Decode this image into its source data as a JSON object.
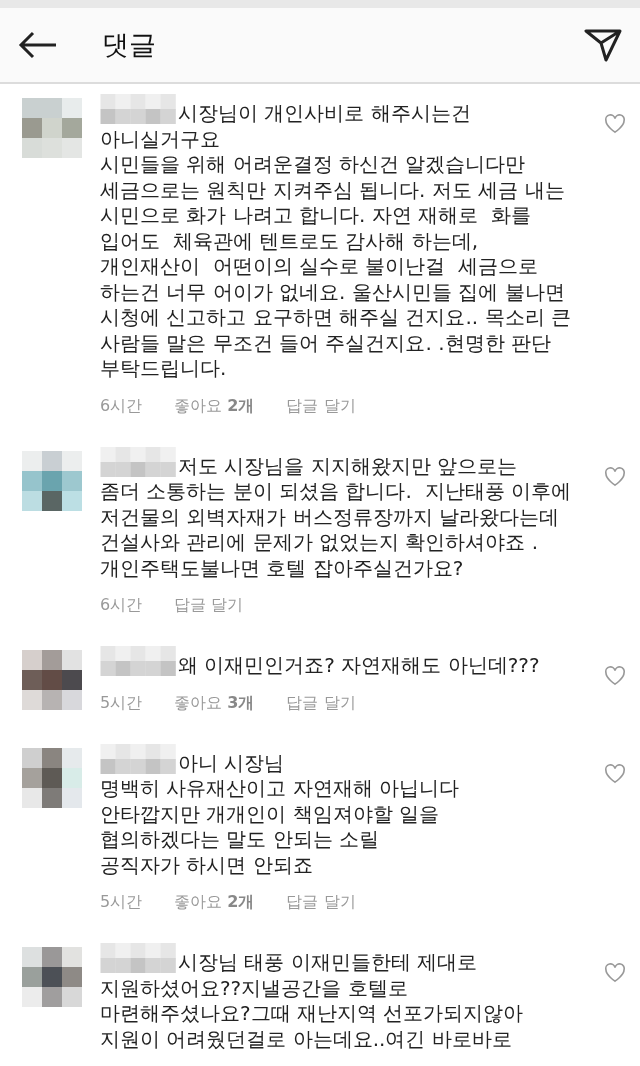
{
  "header": {
    "title": "댓글"
  },
  "comments": [
    {
      "text": "시장님이 개인사비로 해주시는건\n아니실거구요\n시민들을 위해 어려운결정 하신건 알겠습니다만\n세금으로는 원칙만 지켜주심 됩니다. 저도 세금 내는\n시민으로 화가 나려고 합니다. 자연 재해로  화를\n입어도  체육관에 텐트로도 감사해 하는데,\n개인재산이  어떤이의 실수로 불이난걸  세금으로\n하는건 너무 어이가 없네요. 울산시민들 집에 불나면\n시청에 신고하고 요구하면 해주실 건지요.. 목소리 큰\n사람들 말은 무조건 들어 주실건지요. .현명한 판단\n부탁드립니다.",
      "time": "6시간",
      "likes": "좋아요 **2개**",
      "reply": "답글 달기",
      "liked": false
    },
    {
      "text": "저도 시장님을 지지해왔지만 앞으로는\n좀더 소통하는 분이 되셨음 합니다.  지난태풍 이후에\n저건물의 외벽자재가 버스정류장까지 날라왔다는데\n건설사와 관리에 문제가 없었는지 확인하셔야죠 .\n개인주택도불나면 호텔 잡아주실건가요?",
      "time": "6시간",
      "reply": "답글 달기",
      "liked": false
    },
    {
      "text": "왜 이재민인거죠? 자연재해도 아닌데???",
      "time": "5시간",
      "likes": "좋아요 **3개**",
      "reply": "답글 달기",
      "liked": false
    },
    {
      "text": "아니 시장님\n명백히 사유재산이고 자연재해 아닙니다\n안타깝지만 개개인이 책임져야할 일을\n협의하겠다는 말도 안되는 소릴\n공직자가 하시면 안되죠",
      "time": "5시간",
      "likes": "좋아요 **2개**",
      "reply": "답글 달기",
      "liked": false
    },
    {
      "text": "시장님 태풍 이재민들한테 제대로\n지원하셨어요??지낼공간을 호텔로\n마련해주셨나요?그때 재난지역 선포가되지않아\n지원이 어려웠던걸로 아는데요..여긴 바로바로",
      "liked": false
    }
  ]
}
